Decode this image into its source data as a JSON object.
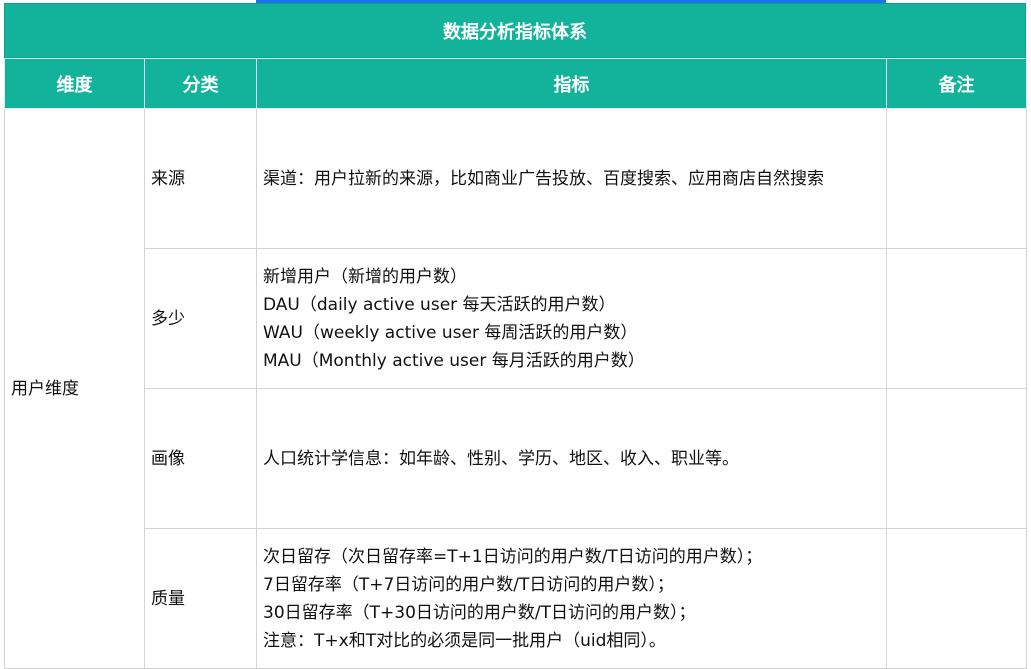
{
  "table": {
    "title": "数据分析指标体系",
    "headers": [
      "维度",
      "分类",
      "指标",
      "备注"
    ],
    "dimension": "用户维度",
    "rows": [
      {
        "category": "来源",
        "metrics": [
          "渠道：用户拉新的来源，比如商业广告投放、百度搜索、应用商店自然搜索"
        ],
        "note": ""
      },
      {
        "category": "多少",
        "metrics": [
          "新增用户（新增的用户数）",
          "DAU（daily active user 每天活跃的用户数）",
          "WAU（weekly active user 每周活跃的用户数）",
          "MAU（Monthly active user 每月活跃的用户数）"
        ],
        "note": ""
      },
      {
        "category": "画像",
        "metrics": [
          "人口统计学信息：如年龄、性别、学历、地区、收入、职业等。"
        ],
        "note": ""
      },
      {
        "category": "质量",
        "metrics": [
          "次日留存（次日留存率=T+1日访问的用户数/T日访问的用户数）；",
          "7日留存率（T+7日访问的用户数/T日访问的用户数）；",
          "30日留存率（T+30日访问的用户数/T日访问的用户数）；",
          "注意：T+x和T对比的必须是同一批用户（uid相同）。"
        ],
        "note": ""
      }
    ]
  },
  "colors": {
    "header_bg": "#12b39a",
    "header_text": "#ffffff",
    "selection_accent": "#1a73e8"
  }
}
